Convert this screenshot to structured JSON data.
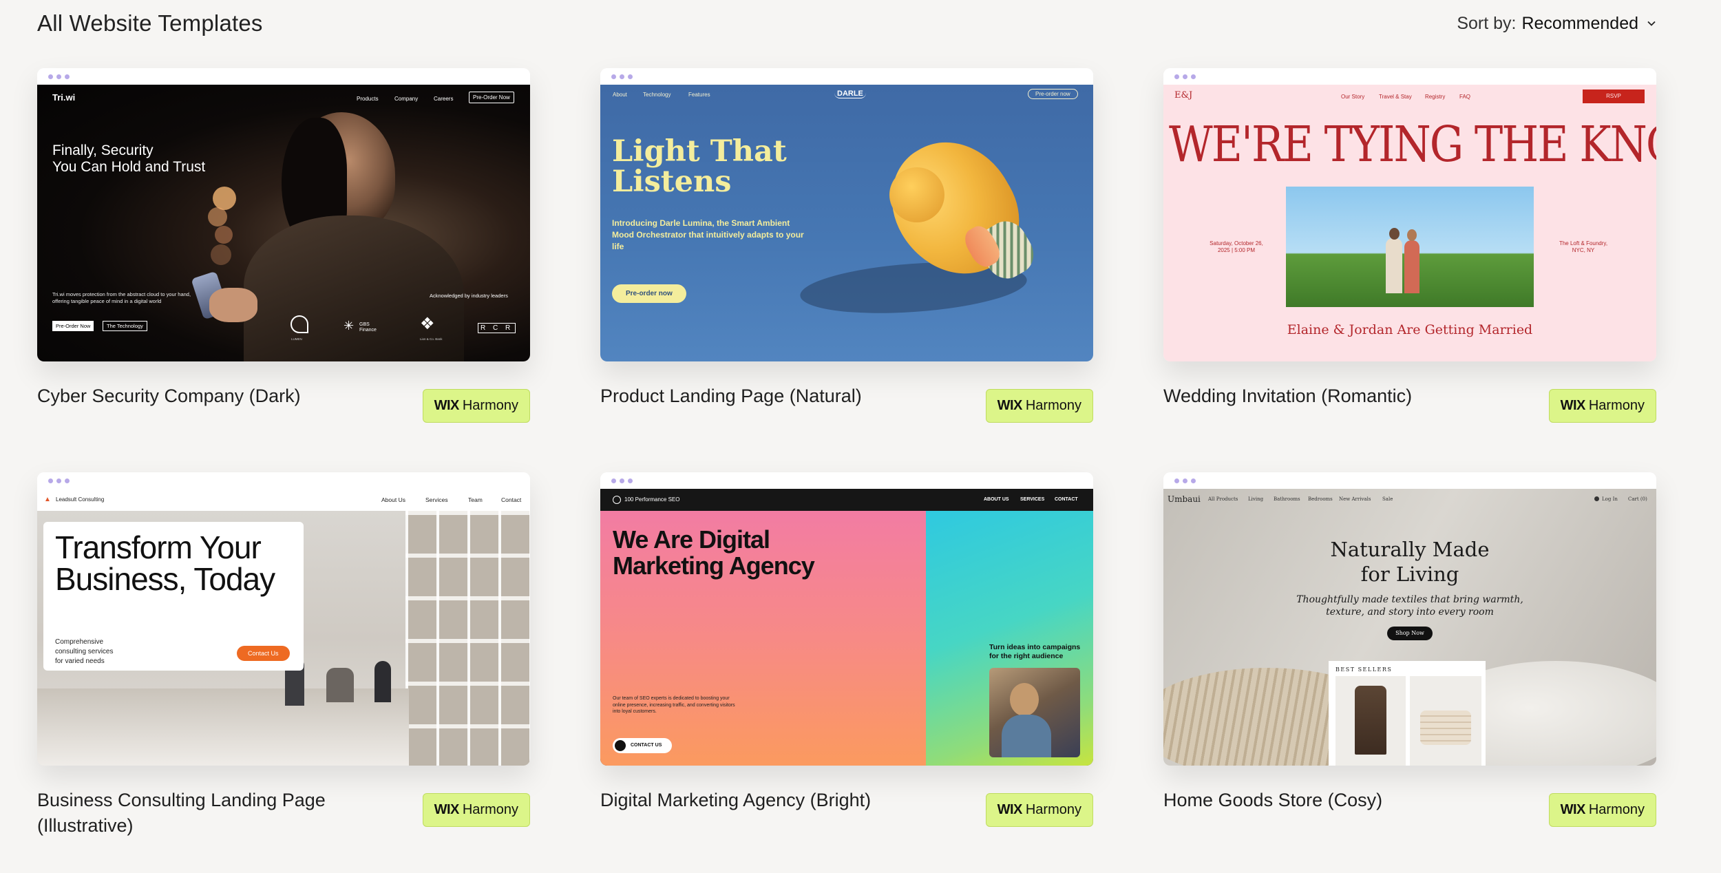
{
  "header": {
    "title": "All Website Templates",
    "sort_prefix": "Sort by:",
    "sort_value": "Recommended"
  },
  "badge": {
    "wix": "WIX",
    "harmony": "Harmony"
  },
  "colors": {
    "badge_bg": "#dcf589",
    "page_bg": "#f6f5f3",
    "browser_dots": "#b7a9e8"
  },
  "templates": [
    {
      "name": "Cyber Security Company (Dark)",
      "preview": {
        "logo": "Tri.wi",
        "nav": [
          "Products",
          "Company",
          "Careers"
        ],
        "cta": "Pre-Order Now",
        "headline_1": "Finally, Security",
        "headline_2": "You Can Hold and Trust",
        "body": "Tri.wi moves protection from the abstract cloud to your hand, offering tangible peace of mind in a digital world",
        "btn_primary": "Pre-Order Now",
        "btn_secondary": "The Technology",
        "ack": "Acknowledged by industry leaders",
        "partners": [
          "LUMEN",
          "GBS Finance",
          "Lion & Co. Bank",
          "R C R"
        ]
      }
    },
    {
      "name": "Product Landing Page (Natural)",
      "preview": {
        "nav": [
          "About",
          "Technology",
          "Features"
        ],
        "logo": "DARLE",
        "cta": "Pre-order now",
        "headline_1": "Light That",
        "headline_2": "Listens",
        "body": "Introducing Darle Lumina, the Smart Ambient Mood Orchestrator that intuitively adapts to your life",
        "button": "Pre-order now"
      }
    },
    {
      "name": "Wedding Invitation (Romantic)",
      "preview": {
        "logo": "E&J",
        "nav": [
          "Our Story",
          "Travel & Stay",
          "Registry",
          "FAQ"
        ],
        "cta": "RSVP",
        "headline": "WE'RE TYING THE KNOT!",
        "date_1": "Saturday, October 26,",
        "date_2": "2025 | 5:00 PM",
        "venue_1": "The Loft & Foundry,",
        "venue_2": "NYC, NY",
        "subtitle": "Elaine & Jordan Are Getting Married"
      }
    },
    {
      "name": "Business Consulting Landing Page (Illustrative)",
      "preview": {
        "logo": "Leadsult Consulting",
        "nav": [
          "About Us",
          "Services",
          "Team",
          "Contact"
        ],
        "headline_1": "Transform Your",
        "headline_2": "Business, Today",
        "body_1": "Comprehensive",
        "body_2": "consulting services",
        "body_3": "for varied needs",
        "button": "Contact Us"
      }
    },
    {
      "name": "Digital Marketing Agency (Bright)",
      "preview": {
        "logo": "100 Performance SEO",
        "nav": [
          "ABOUT US",
          "SERVICES",
          "CONTACT"
        ],
        "headline_1": "We Are Digital",
        "headline_2": "Marketing Agency",
        "body": "Our team of SEO experts is dedicated to boosting your online presence, increasing traffic, and converting visitors into loyal customers.",
        "button": "CONTACT US",
        "side_1": "Turn ideas into campaigns",
        "side_2": "for the right audience"
      }
    },
    {
      "name": "Home Goods Store (Cosy)",
      "preview": {
        "logo": "Umbaui",
        "nav": [
          "All Products",
          "Living",
          "Bathrooms",
          "Bedrooms",
          "New Arrivals",
          "Sale"
        ],
        "login": "Log In",
        "cart": "Cart (0)",
        "headline_1": "Naturally Made",
        "headline_2": "for Living",
        "sub_1": "Thoughtfully made textiles that bring warmth,",
        "sub_2": "texture, and story into every room",
        "button": "Shop Now",
        "section": "BEST SELLERS"
      }
    }
  ]
}
